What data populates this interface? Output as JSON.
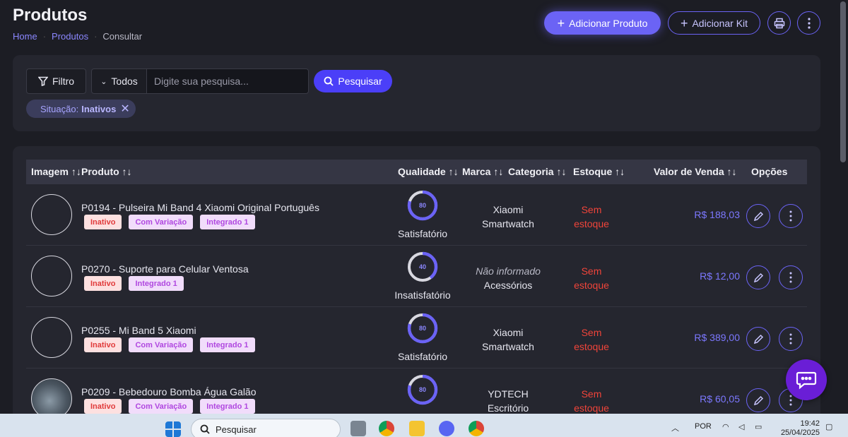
{
  "header": {
    "title": "Produtos",
    "breadcrumb": [
      "Home",
      "Produtos",
      "Consultar"
    ],
    "add_product_label": "Adicionar Produto",
    "add_kit_label": "Adicionar Kit"
  },
  "search": {
    "filter_label": "Filtro",
    "scope_label": "Todos",
    "placeholder": "Digite sua pesquisa...",
    "button_label": "Pesquisar",
    "chip_key": "Situação:",
    "chip_value": "Inativos"
  },
  "table": {
    "columns": [
      "Imagem",
      "Produto",
      "Qualidade",
      "Marca",
      "Categoria",
      "Estoque",
      "Valor de Venda",
      "Opções"
    ],
    "sort_glyph": "↑↓",
    "rows": [
      {
        "product": "P0194 - Pulseira Mi Band 4 Xiaomi Original Português",
        "tags": [
          "Inativo",
          "Com Variação",
          "Integrado 1"
        ],
        "quality": 80,
        "quality_label": "Satisfatório",
        "brand": "Xiaomi",
        "category": "Smartwatch",
        "stock_l1": "Sem",
        "stock_l2": "estoque",
        "price": "R$ 188,03"
      },
      {
        "product": "P0270 - Suporte para Celular Ventosa",
        "tags": [
          "Inativo",
          "Integrado 1"
        ],
        "quality": 40,
        "quality_label": "Insatisfatório",
        "brand": "Não informado",
        "category": "Acessórios",
        "stock_l1": "Sem",
        "stock_l2": "estoque",
        "price": "R$ 12,00"
      },
      {
        "product": "P0255 - Mi Band 5 Xiaomi",
        "tags": [
          "Inativo",
          "Com Variação",
          "Integrado 1"
        ],
        "quality": 80,
        "quality_label": "Satisfatório",
        "brand": "Xiaomi",
        "category": "Smartwatch",
        "stock_l1": "Sem",
        "stock_l2": "estoque",
        "price": "R$ 389,00"
      },
      {
        "product": "P0209 - Bebedouro Bomba Água Galão",
        "tags": [
          "Inativo",
          "Com Variação",
          "Integrado 1"
        ],
        "quality": 80,
        "quality_label": "",
        "brand": "YDTECH",
        "category": "Escritório",
        "stock_l1": "Sem",
        "stock_l2": "estoque",
        "price": "R$ 60,05"
      }
    ]
  },
  "taskbar": {
    "search_label": "Pesquisar",
    "language": "POR",
    "time": "19:42",
    "date": "25/04/2025"
  },
  "colors": {
    "accent": "#6b63f5",
    "danger": "#f0443a",
    "background": "#1c1d24",
    "panel": "#25262f"
  }
}
